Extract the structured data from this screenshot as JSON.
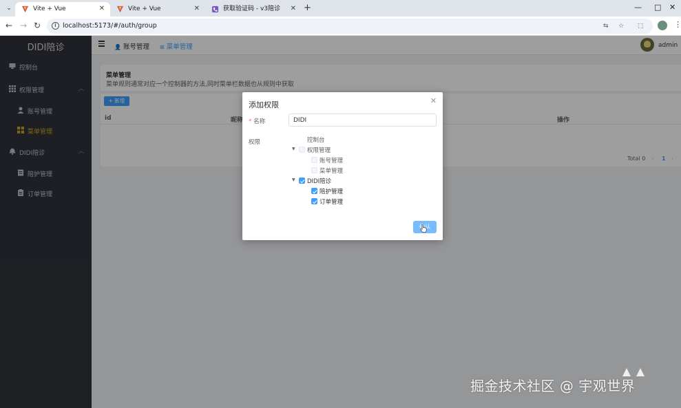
{
  "browser": {
    "tabs": [
      {
        "title": "Vite + Vue",
        "active": true
      },
      {
        "title": "Vite + Vue",
        "active": false
      },
      {
        "title": "获取验证码 - v3陪诊",
        "active": false
      }
    ],
    "url": "localhost:5173/#/auth/group",
    "new_tab_glyph": "+",
    "nav": {
      "back": "←",
      "forward": "→",
      "reload": "↻"
    },
    "window": {
      "minimize": "—",
      "maximize": "□",
      "close": "✕"
    }
  },
  "sidebar": {
    "title": "DIDI陪诊",
    "items": [
      {
        "label": "控制台",
        "icon": "monitor-icon"
      },
      {
        "label": "权限管理",
        "icon": "grid-icon"
      },
      {
        "label": "账号管理",
        "icon": "user-icon"
      },
      {
        "label": "菜单管理",
        "icon": "menu-grid-icon"
      },
      {
        "label": "DIDI陪诊",
        "icon": "bell-icon"
      },
      {
        "label": "陪护管理",
        "icon": "document-icon"
      },
      {
        "label": "订单管理",
        "icon": "clipboard-icon"
      }
    ],
    "active_label": "菜单管理"
  },
  "header": {
    "tabs": [
      {
        "label": "账号管理"
      },
      {
        "label": "菜单管理"
      }
    ],
    "username": "admin"
  },
  "panel": {
    "title": "菜单管理",
    "description": "菜单规则通常对应一个控制器的方法,同时菜单栏数据也从规则中获取"
  },
  "table": {
    "add_button": "+ 新增",
    "columns": [
      "id",
      "昵称",
      "操作"
    ],
    "total": "Total 0",
    "page": "1",
    "prev": "‹",
    "next": "›"
  },
  "dialog": {
    "title": "添加权限",
    "close": "✕",
    "name_label": "名称",
    "name_value": "DIDI",
    "perm_label": "权限",
    "tree": [
      {
        "label": "控制台",
        "level": 0,
        "caret": false,
        "checkbox": "disabled"
      },
      {
        "label": "权限管理",
        "level": 0,
        "caret": true,
        "checkbox": "disabled"
      },
      {
        "label": "账号管理",
        "level": 1,
        "caret": false,
        "checkbox": "disabled"
      },
      {
        "label": "菜单管理",
        "level": 1,
        "caret": false,
        "checkbox": "disabled"
      },
      {
        "label": "DIDI陪诊",
        "level": 0,
        "caret": true,
        "checkbox": "checked"
      },
      {
        "label": "陪护管理",
        "level": 1,
        "caret": false,
        "checkbox": "checked"
      },
      {
        "label": "订单管理",
        "level": 1,
        "caret": false,
        "checkbox": "checked"
      }
    ],
    "confirm": "确认"
  },
  "watermark": {
    "text": "掘金技术社区 @ 宇观世界"
  },
  "colors": {
    "primary": "#409eff",
    "sidebar_bg": "#30333a",
    "active_menu": "#c9a227"
  }
}
